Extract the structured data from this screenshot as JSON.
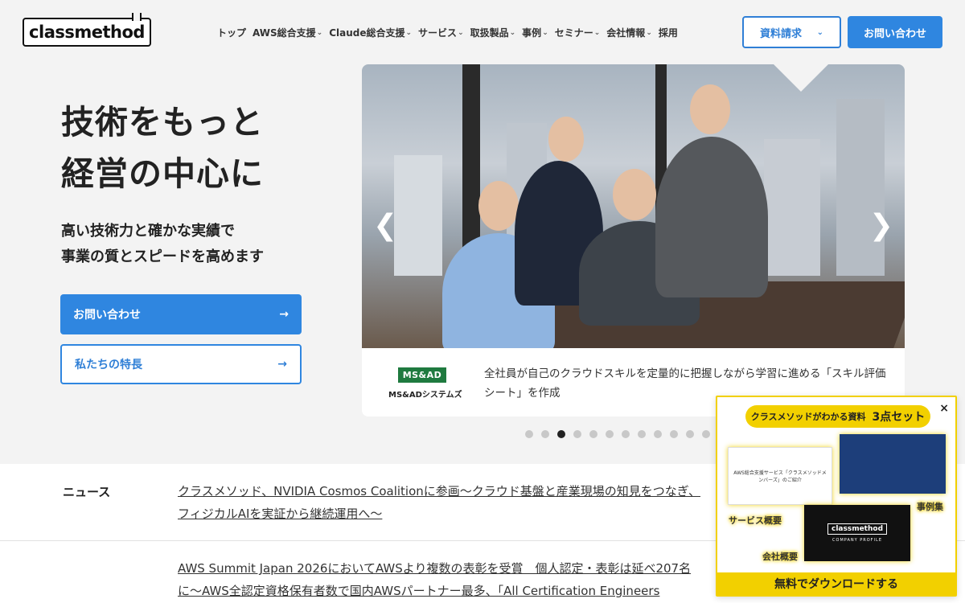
{
  "header": {
    "logo": "classmethod",
    "nav": [
      {
        "label": "トップ",
        "has_menu": false
      },
      {
        "label": "AWS総合支援",
        "has_menu": true
      },
      {
        "label": "Claude総合支援",
        "has_menu": true
      },
      {
        "label": "サービス",
        "has_menu": true
      },
      {
        "label": "取扱製品",
        "has_menu": true
      },
      {
        "label": "事例",
        "has_menu": true
      },
      {
        "label": "セミナー",
        "has_menu": true
      },
      {
        "label": "会社情報",
        "has_menu": true
      },
      {
        "label": "採用",
        "has_menu": false
      }
    ],
    "docs_button": "資料請求",
    "contact_button": "お問い合わせ"
  },
  "hero": {
    "title_line1": "技術をもっと",
    "title_line2": "経営の中心に",
    "sub_line1": "高い技術力と確かな実績で",
    "sub_line2": "事業の質とスピードを高めます",
    "primary_button": "お問い合わせ",
    "secondary_button": "私たちの特長",
    "arrow": "→"
  },
  "slider": {
    "client_logo_mark": "MS&AD",
    "client_name": "MS&ADシステムズ",
    "caption": "全社員が自己のクラウドスキルを定量的に把握しながら学習に進める「スキル評価シート」を作成",
    "prev": "❮",
    "next": "❯",
    "dot_count": 12,
    "active_dot": 2
  },
  "news": {
    "label": "ニュース",
    "items": [
      "クラスメソッド、NVIDIA Cosmos Coalitionに参画〜クラウド基盤と産業現場の知見をつなぎ、フィジカルAIを実証から継続運用へ〜",
      "AWS Summit Japan 2026においてAWSより複数の表彰を受賞　個人認定・表彰は延べ207名に〜AWS全認定資格保有者数で国内AWSパートナー最多、「All Certification Engineers"
    ]
  },
  "popup": {
    "close": "×",
    "badge_text": "クラスメソッドがわかる資料",
    "badge_emph": "3点セット",
    "doc_service_text": "AWS総合支援サービス「クラスメソッドメンバーズ」のご紹介",
    "doc_company_logo": "classmethod",
    "doc_company_sub": "COMPANY PROFILE",
    "label_service": "サービス概要",
    "label_cases": "事例集",
    "label_company": "会社概要",
    "cta": "無料でダウンロードする"
  },
  "colors": {
    "brand_blue": "#2f86e0",
    "popup_yellow": "#f2d000",
    "msad_green": "#1f7a3f"
  }
}
